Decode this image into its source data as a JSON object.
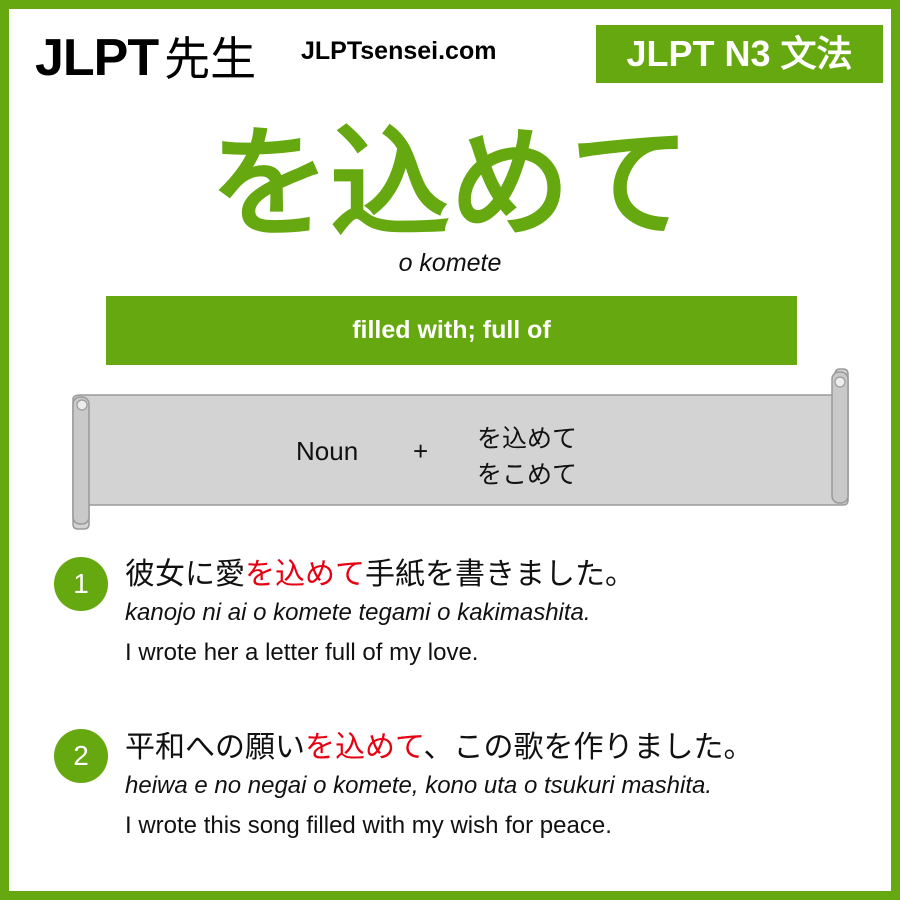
{
  "header": {
    "logo_latin": "JLPT",
    "logo_kanji": "先生",
    "site": "JLPTsensei.com",
    "level_badge": "JLPT N3 文法"
  },
  "grammar": {
    "title": "を込めて",
    "romaji": "o komete",
    "meaning": "filled with; full of"
  },
  "formula": {
    "part": "Noun",
    "plus": "+",
    "forms": [
      "を込めて",
      "をこめて"
    ]
  },
  "examples": [
    {
      "number": "1",
      "jp_before": "彼女に愛",
      "jp_highlight": "を込めて",
      "jp_after": "手紙を書きました。",
      "romaji": "kanojo ni ai o komete tegami o kakimashita.",
      "english": "I wrote her a letter full of my love."
    },
    {
      "number": "2",
      "jp_before": "平和への願い",
      "jp_highlight": "を込めて",
      "jp_after": "、この歌を作りました。",
      "romaji": "heiwa e no negai o komete, kono uta o tsukuri mashita.",
      "english": "I wrote this song filled with my wish for peace."
    }
  ],
  "colors": {
    "brand_green": "#66a80f",
    "highlight_red": "#e60012",
    "scroll_fill": "#d3d3d3"
  }
}
